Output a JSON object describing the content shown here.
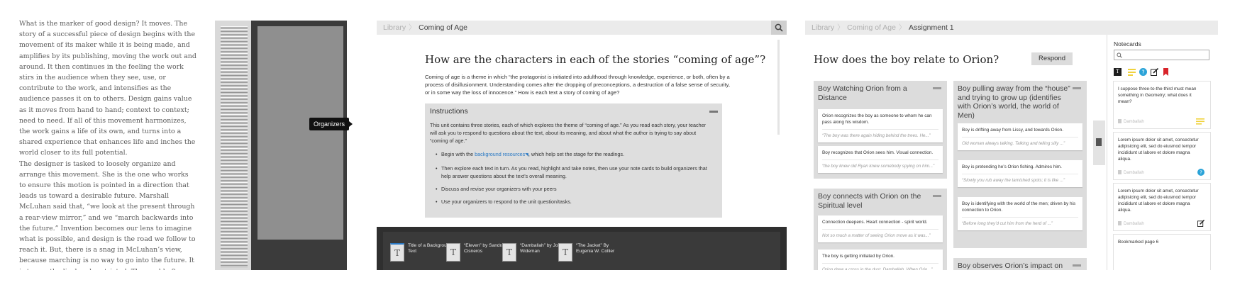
{
  "essay": {
    "paragraphs": [
      "What is the marker of good design? It moves. The story of a successful piece of design begins with the movement of its maker while it is being made, and amplifies by its publishing, moving the work out and around. It then continues in the feeling the work stirs in the audience when they see, use, or contribute to the work, and intensifies as the audience passes it on to others. Design gains value as it moves from hand to hand; context to context; need to need. If all of this movement harmonizes, the work gains a life of its own, and turns into a shared experience that enhances life and inches the world closer to its full potential.",
      "The designer is tasked to loosely organize and arrange this movement. She is the one who works to ensure this motion is pointed in a direction that leads us toward a desirable future. Marshall McLuhan said that, “we look at the present through a rear-view mirror,” and we “march backwards into the future.” Invention becomes our lens to imagine what is possible, and design is the road we follow to reach it. But, there is a snag in McLuhan’s view, because marching is no way to go into the future. It is too methodical and restricted. The world often subverts our best laid plans, so our road calls for a way to move that is"
    ]
  },
  "reader": {
    "organizers_tab": "Organizers"
  },
  "coming_of_age": {
    "breadcrumb": [
      "Library",
      "Coming of Age"
    ],
    "question": "How are the characters in each of the stories “coming of age”?",
    "intro": "Coming of age is a theme in which “the protagonist is initiated into adulthood through knowledge, experience, or both, often by a process of disillusionment. Understanding comes after the dropping of preconceptions, a destruction of a false sense of security, or in some way the loss of innocence.”  How is each text a story of  coming of age?",
    "instructions": {
      "title": "Instructions",
      "body": "This unit contains three stories, each of which explores the theme of “coming of age.” As you read each story, your teacher will ask you to respond to questions about the text, about its meaning, and about what the author is trying to say about “coming of age.”",
      "bullet1_pre": "Begin with the ",
      "bullet1_link": "background resources",
      "bullet1_post": ", which help set the stage for the readings.",
      "bullet2": "Then explore each text in turn. As you read, highlight and take notes, then use your note cards to build organizers that help answer questions about the text’s overall meaning.",
      "bullet3": "Discuss and revise your organizers with your peers",
      "bullet4": "Use your organizers to respond to the unit question/tasks."
    },
    "texts": [
      {
        "icon": "T",
        "label": "Title of a Background Text"
      },
      {
        "icon": "T",
        "label": "“Eleven” by Sandra Cisneros"
      },
      {
        "icon": "T",
        "label": "“Damballah” by John Wideman"
      },
      {
        "icon": "T",
        "label": "“The Jacket” By Eugenia W. Collier"
      }
    ]
  },
  "assignment": {
    "breadcrumb": [
      "Library",
      "Coming of Age",
      "Assignment 1"
    ],
    "question": "How does the boy relate to Orion?",
    "respond_label": "Respond",
    "groups": [
      {
        "title": "Boy Watching Orion from a Distance",
        "cards": [
          {
            "text": "Orion recognizes the boy as someone to whom he can pass along his wisdom.",
            "quote": "“The boy was there again hiding behind the trees. He...”"
          },
          {
            "text": "Boy recognizes that Orion sees him. Visual connection.",
            "quote": "“the boy knew old Ryan knew somebody spying on him...”"
          }
        ]
      },
      {
        "title": "Boy connects with Orion on the Spiritual level",
        "cards": [
          {
            "text": "Connection deepens. Heart connection - spirit world.",
            "quote": "Not so much a matter of seeing Orion move as it was...”"
          },
          {
            "text": "The boy is getting initiated by Orion.",
            "quote": "Orion drew a cross in the dust. Damballah. When Orio...”"
          }
        ]
      },
      {
        "title": "Boy pulling away from the “house” and trying to grow up (identifies with Orion’s world, the world of Men)",
        "cards": [
          {
            "text": "Boy is drifting away from Lissy, and towards Orion.",
            "quote": "Old woman always talking. Talking and telling silly ...”"
          },
          {
            "text": "Boy is pretending he’s Orion fishing. Admires him.",
            "quote": "“Slowly you rub away the tarnished spots; it is like ...”"
          },
          {
            "text": "Boy is identifying with the world of the men; driven by his connection to Orion.",
            "quote": "“Before long they’d cut him from the herd of ...”"
          }
        ]
      },
      {
        "title": "Boy observes Orion’s impact on others",
        "cards": []
      }
    ],
    "notecards": {
      "title": "Notecards",
      "search_placeholder": "",
      "items": [
        {
          "text": "I suppose three-to-the-third must mean something in Geometry; what does it mean?",
          "source": "Damballah",
          "badge": "highlight-lines-icon"
        },
        {
          "text": "Lorem ipsum dolor sit amet, consectetur adipisicing elit, sed do eiusmod tempor incididunt ut labore et dolore magna aliqua.",
          "source": "Damballah",
          "badge": "question-icon"
        },
        {
          "text": "Lorem ipsum dolor sit amet, consectetur adipisicing elit, sed do eiusmod tempor incididunt ut labore et dolore magna aliqua.",
          "source": "Damballah",
          "badge": "edit-icon"
        },
        {
          "text": "Bookmarked page 6",
          "source": "",
          "badge": ""
        }
      ]
    }
  },
  "colors": {
    "accent_blue": "#2a79c4",
    "highlight_yellow": "#f0d23c",
    "bookmark_red": "#d8232a",
    "question_teal": "#2aa3d8"
  }
}
